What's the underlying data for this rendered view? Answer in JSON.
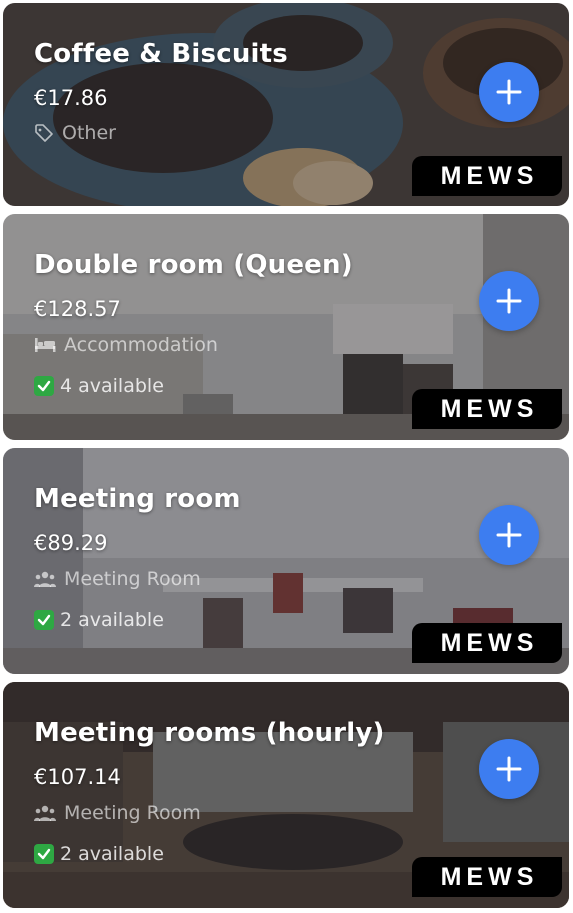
{
  "colors": {
    "accent": "#3d7df0",
    "check_green": "#2ea843",
    "badge_bg": "#000000"
  },
  "products": [
    {
      "title": "Coffee & Biscuits",
      "price": "€17.86",
      "category": "Other",
      "category_icon": "tag-icon",
      "availability": "",
      "brand": "MEWS"
    },
    {
      "title": "Double room (Queen)",
      "price": "€128.57",
      "category": "Accommodation",
      "category_icon": "bed-icon",
      "availability": "4 available",
      "brand": "MEWS"
    },
    {
      "title": "Meeting room",
      "price": "€89.29",
      "category": "Meeting Room",
      "category_icon": "people-icon",
      "availability": "2 available",
      "brand": "MEWS"
    },
    {
      "title": "Meeting rooms (hourly)",
      "price": "€107.14",
      "category": "Meeting Room",
      "category_icon": "people-icon",
      "availability": "2 available",
      "brand": "MEWS"
    }
  ]
}
